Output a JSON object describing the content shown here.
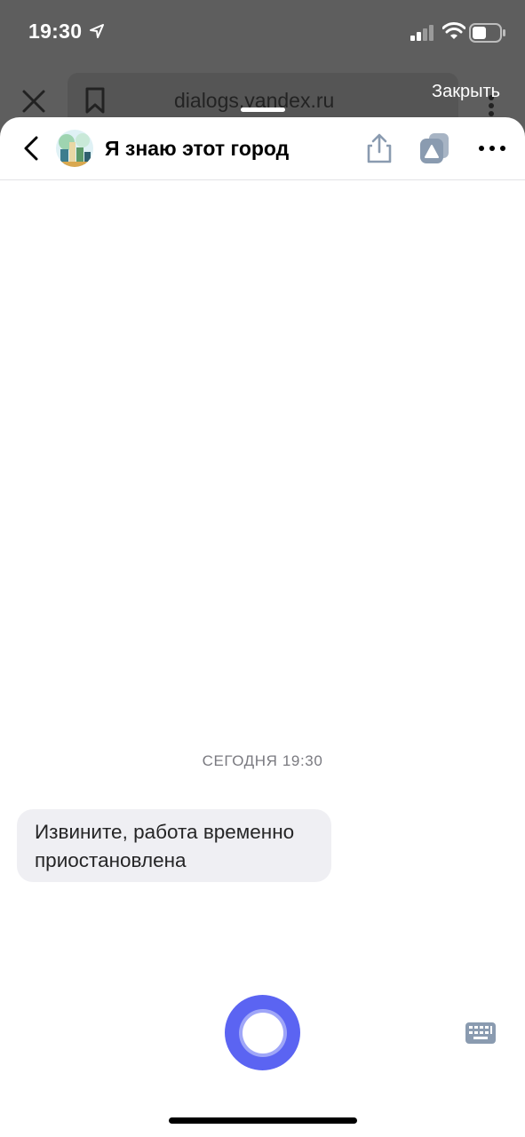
{
  "status_bar": {
    "time": "19:30"
  },
  "browser": {
    "url": "dialogs.yandex.ru",
    "close_label": "Закрыть"
  },
  "header": {
    "title": "Я знаю этот город"
  },
  "chat": {
    "date_label": "СЕГОДНЯ 19:30",
    "messages": [
      {
        "from": "skill",
        "text": "Извините, работа временно приостановлена"
      }
    ]
  },
  "colors": {
    "accent": "#5b64f2",
    "bubble": "#efeff3",
    "icon_gray": "#8a9bb0"
  }
}
